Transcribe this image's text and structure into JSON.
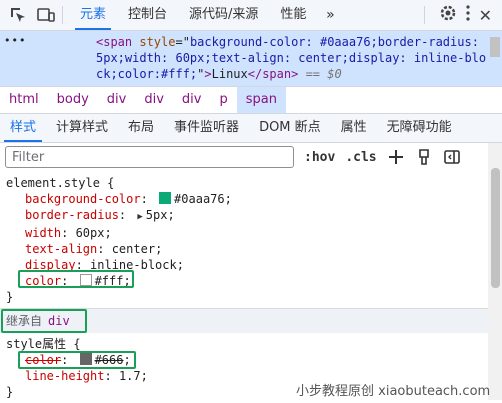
{
  "topbar": {
    "tabs": [
      "元素",
      "控制台",
      "源代码/来源",
      "性能"
    ],
    "active_tab": "元素",
    "more_glyph": "»"
  },
  "source": {
    "dots": "•••",
    "open_tag": "<span",
    "style_attr": "style",
    "style_value": "background-color: #0aaa76;border-radius: 5px;width: 60px;text-align: center;display: inline-block;color:#fff;",
    "text": "Linux",
    "close_tag": "</span>",
    "suffix": "== $0"
  },
  "breadcrumbs": [
    "html",
    "body",
    "div",
    "div",
    "div",
    "p",
    "span"
  ],
  "subtabs": [
    "样式",
    "计算样式",
    "布局",
    "事件监听器",
    "DOM 断点",
    "属性",
    "无障碍功能"
  ],
  "filter": {
    "placeholder": "Filter",
    "hov": ":hov",
    "cls": ".cls"
  },
  "element_style": {
    "selector": "element.style {",
    "declarations": [
      {
        "prop": "background-color",
        "value": "#0aaa76",
        "swatch": "#0aaa76"
      },
      {
        "prop": "border-radius",
        "value": "5px",
        "triangle": true
      },
      {
        "prop": "width",
        "value": "60px"
      },
      {
        "prop": "text-align",
        "value": "center"
      },
      {
        "prop": "display",
        "value": "inline-block"
      },
      {
        "prop": "color",
        "value": "#fff",
        "swatch": "#ffffff"
      }
    ],
    "close": "}"
  },
  "inherited": {
    "label": "继承自",
    "tag": "div"
  },
  "style_attr_rule": {
    "selector": "style属性 {",
    "declarations": [
      {
        "prop": "color",
        "value": "#666",
        "swatch": "#666666",
        "strike": true
      },
      {
        "prop": "line-height",
        "value": "1.7"
      }
    ],
    "close": "}"
  },
  "watermark": "小步教程原创 xiaobuteach.com",
  "colors": {
    "accent": "#1a73e8",
    "highlight_box": "#18a058",
    "tag": "#881280",
    "prop": "#c80000"
  }
}
